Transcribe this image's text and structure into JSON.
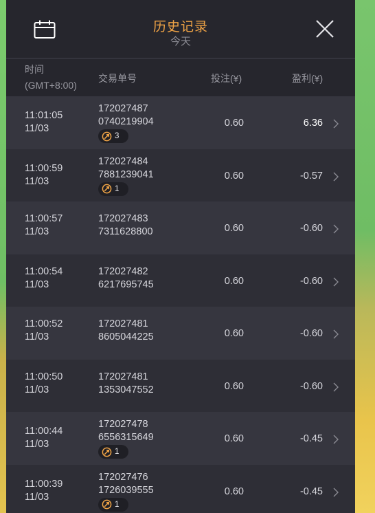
{
  "header": {
    "title": "历史记录",
    "subtitle": "今天"
  },
  "columns": {
    "time_line1": "时间",
    "time_line2": "(GMT+8:00)",
    "order": "交易单号",
    "bet": "投注(¥)",
    "profit": "盈利(¥)"
  },
  "colors": {
    "accent": "#f0a446",
    "panel": "#2e2e36",
    "row_alt": "#36363f"
  },
  "rows": [
    {
      "time": "11:01:05",
      "date": "11/03",
      "id1": "172027487",
      "id2": "0740219904",
      "bet": "0.60",
      "profit": "6.36",
      "badge": "3"
    },
    {
      "time": "11:00:59",
      "date": "11/03",
      "id1": "172027484",
      "id2": "7881239041",
      "bet": "0.60",
      "profit": "-0.57",
      "badge": "1"
    },
    {
      "time": "11:00:57",
      "date": "11/03",
      "id1": "172027483",
      "id2": "7311628800",
      "bet": "0.60",
      "profit": "-0.60",
      "badge": null
    },
    {
      "time": "11:00:54",
      "date": "11/03",
      "id1": "172027482",
      "id2": "6217695745",
      "bet": "0.60",
      "profit": "-0.60",
      "badge": null
    },
    {
      "time": "11:00:52",
      "date": "11/03",
      "id1": "172027481",
      "id2": "8605044225",
      "bet": "0.60",
      "profit": "-0.60",
      "badge": null
    },
    {
      "time": "11:00:50",
      "date": "11/03",
      "id1": "172027481",
      "id2": "1353047552",
      "bet": "0.60",
      "profit": "-0.60",
      "badge": null
    },
    {
      "time": "11:00:44",
      "date": "11/03",
      "id1": "172027478",
      "id2": "6556315649",
      "bet": "0.60",
      "profit": "-0.45",
      "badge": "1"
    },
    {
      "time": "11:00:39",
      "date": "11/03",
      "id1": "172027476",
      "id2": "1726039555",
      "bet": "0.60",
      "profit": "-0.45",
      "badge": "1"
    }
  ]
}
